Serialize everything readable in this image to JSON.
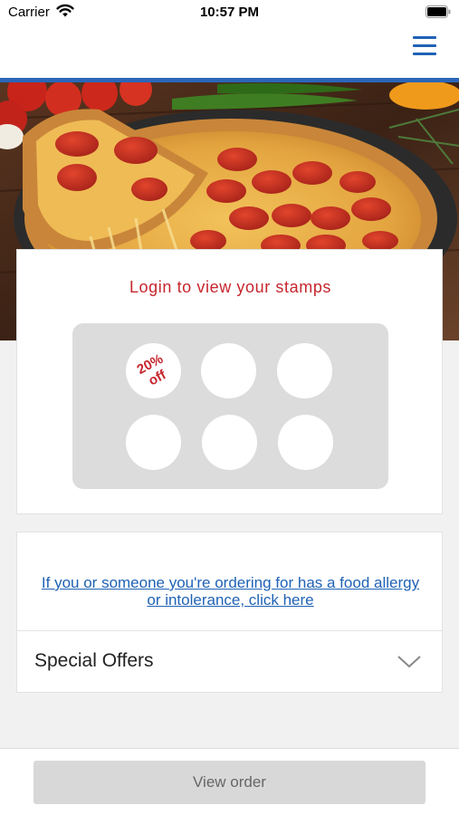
{
  "status_bar": {
    "carrier": "Carrier",
    "time": "10:57 PM"
  },
  "nav": {
    "menu_icon": "hamburger-menu-icon",
    "accent_color": "#1f62b5"
  },
  "hero": {
    "image": "pepperoni pizza photo"
  },
  "stamp_card": {
    "title": "Login to view your stamps",
    "stamps": [
      {
        "reward_line1": "20%",
        "reward_line2": "off"
      },
      {
        "reward_line1": "",
        "reward_line2": ""
      },
      {
        "reward_line1": "",
        "reward_line2": ""
      },
      {
        "reward_line1": "",
        "reward_line2": ""
      },
      {
        "reward_line1": "",
        "reward_line2": ""
      },
      {
        "reward_line1": "",
        "reward_line2": ""
      }
    ],
    "title_color": "#c6262e"
  },
  "allergy": {
    "link_text": "If you or someone you're ordering for has a food allergy or intolerance, click here"
  },
  "offers": {
    "label": "Special Offers"
  },
  "bottom_bar": {
    "view_order_label": "View order"
  }
}
